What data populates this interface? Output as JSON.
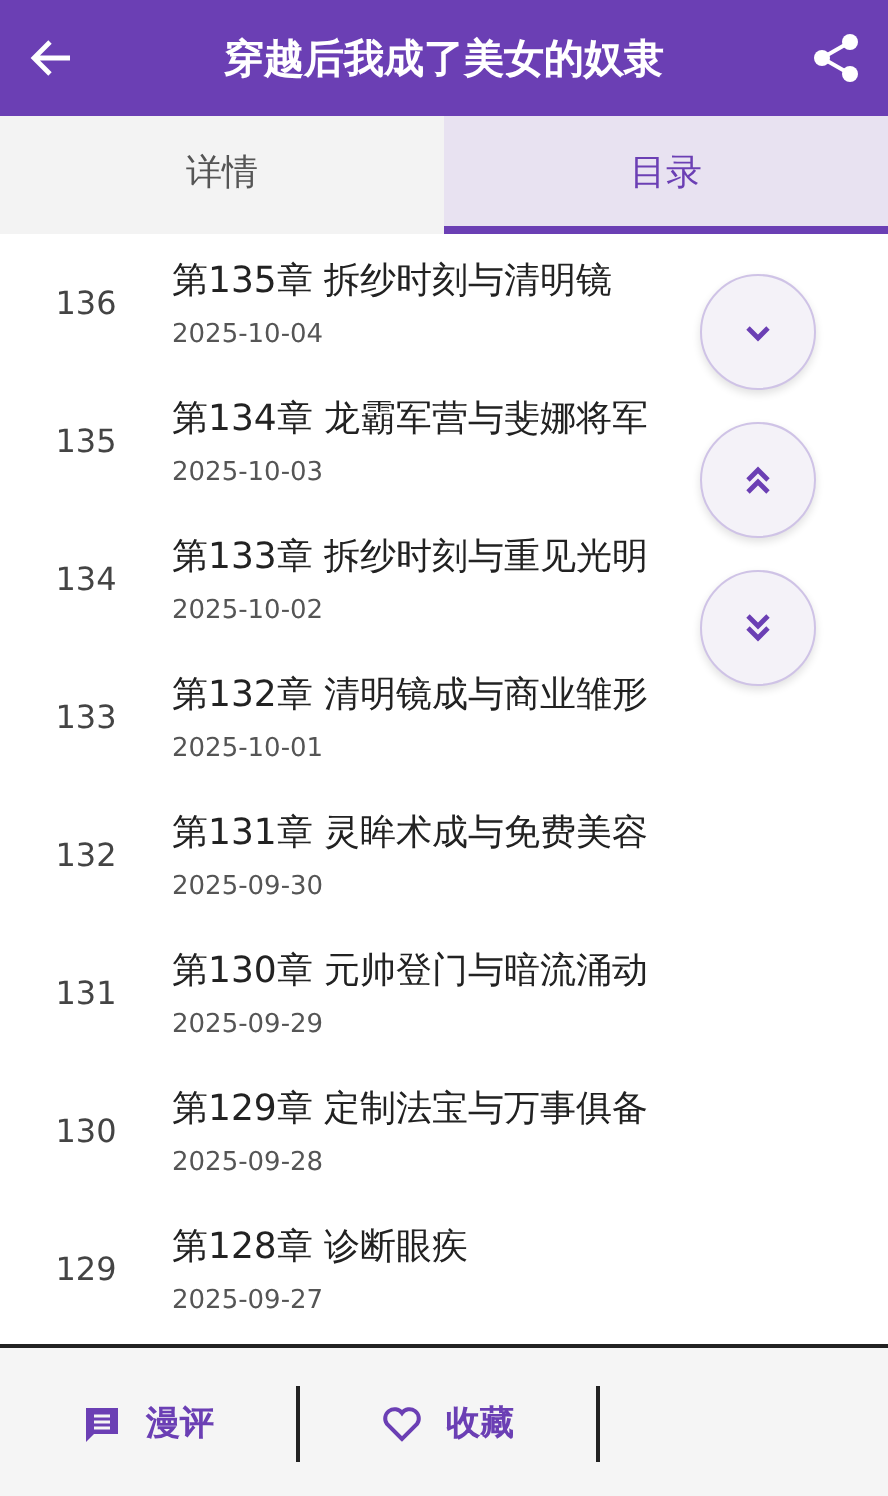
{
  "header": {
    "title": "穿越后我成了美女的奴隶"
  },
  "tabs": [
    {
      "label": "详情",
      "selected": false
    },
    {
      "label": "目录",
      "selected": true
    }
  ],
  "chapters": [
    {
      "index": "136",
      "title": "第135章 拆纱时刻与清明镜",
      "date": "2025-10-04"
    },
    {
      "index": "135",
      "title": "第134章 龙霸军营与斐娜将军",
      "date": "2025-10-03"
    },
    {
      "index": "134",
      "title": "第133章 拆纱时刻与重见光明",
      "date": "2025-10-02"
    },
    {
      "index": "133",
      "title": "第132章 清明镜成与商业雏形",
      "date": "2025-10-01"
    },
    {
      "index": "132",
      "title": "第131章 灵眸术成与免费美容",
      "date": "2025-09-30"
    },
    {
      "index": "131",
      "title": "第130章 元帅登门与暗流涌动",
      "date": "2025-09-29"
    },
    {
      "index": "130",
      "title": "第129章 定制法宝与万事俱备",
      "date": "2025-09-28"
    },
    {
      "index": "129",
      "title": "第128章 诊断眼疾",
      "date": "2025-09-27"
    }
  ],
  "bottom_bar": [
    {
      "kind": "comment",
      "label": "漫评"
    },
    {
      "kind": "favorite",
      "label": "收藏"
    }
  ]
}
